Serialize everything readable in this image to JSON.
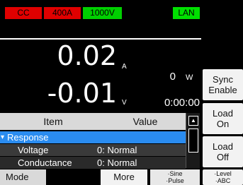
{
  "status": {
    "mode": "CC",
    "current_range": "400A",
    "voltage_range": "1000V",
    "interface": "LAN"
  },
  "readout": {
    "current_value": "0.02",
    "current_unit": "A",
    "voltage_value": "-0.01",
    "voltage_unit": "V",
    "power_value": "0",
    "power_unit": "W",
    "timer": "0:00:00"
  },
  "softkeys_right": {
    "sync_line1": "Sync",
    "sync_line2": "Enable",
    "load_on_line1": "Load",
    "load_on_line2": "On",
    "load_off_line1": "Load",
    "load_off_line2": "Off",
    "level_line1": "·Level",
    "level_line2": "·ABC"
  },
  "table": {
    "header_item": "Item",
    "header_value": "Value",
    "rows": [
      {
        "label": "Response",
        "value": ""
      },
      {
        "label": "Voltage",
        "value": "0: Normal"
      },
      {
        "label": "Conductance",
        "value": "0: Normal"
      }
    ]
  },
  "softkeys_bottom": {
    "mode": "Mode",
    "more": "More",
    "sine_line1": "·Sine",
    "sine_line2": "·Pulse"
  },
  "colors": {
    "alarm_red": "#e00000",
    "ok_green": "#00d000",
    "selection_blue": "#2a8cf0"
  }
}
